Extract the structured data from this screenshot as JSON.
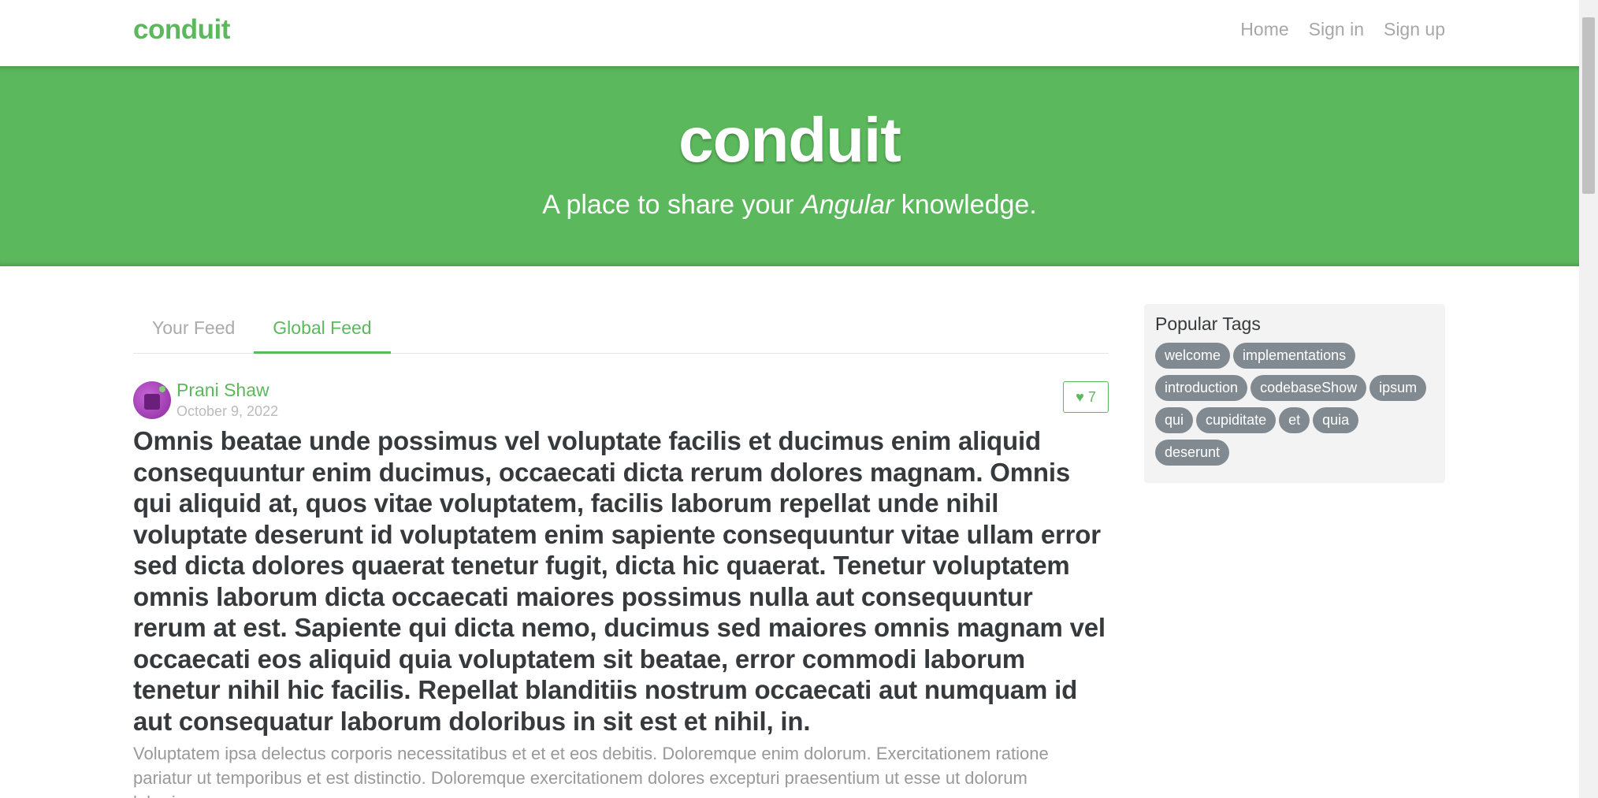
{
  "navbar": {
    "brand": "conduit",
    "links": [
      "Home",
      "Sign in",
      "Sign up"
    ]
  },
  "banner": {
    "title": "conduit",
    "subtitle_before": "A place to share your ",
    "subtitle_emphasis": "Angular",
    "subtitle_after": " knowledge."
  },
  "feed": {
    "tabs": [
      "Your Feed",
      "Global Feed"
    ],
    "active_tab": "Global Feed"
  },
  "article": {
    "author": "Prani Shaw",
    "date": "October 9, 2022",
    "likes": "7",
    "title": "Omnis beatae unde possimus vel voluptate facilis et ducimus enim aliquid consequuntur enim ducimus, occaecati dicta rerum dolores magnam. Omnis qui aliquid at, quos vitae voluptatem, facilis laborum repellat unde nihil voluptate deserunt id voluptatem enim sapiente consequuntur vitae ullam error sed dicta dolores quaerat tenetur fugit, dicta hic quaerat. Tenetur voluptatem omnis laborum dicta occaecati maiores possimus nulla aut consequuntur rerum at est. Sapiente qui dicta nemo, ducimus sed maiores omnis magnam vel occaecati eos aliquid quia voluptatem sit beatae, error commodi laborum tenetur nihil hic facilis. Repellat blanditiis nostrum occaecati aut numquam id aut consequatur laborum doloribus in sit est et nihil, in.",
    "description": "Voluptatem ipsa delectus corporis necessitatibus et et et eos debitis. Doloremque enim dolorum. Exercitationem ratione pariatur ut temporibus et est distinctio. Doloremque exercitationem dolores excepturi praesentium ut esse ut dolorum laboriosam."
  },
  "sidebar": {
    "title": "Popular Tags",
    "tags": [
      "welcome",
      "implementations",
      "introduction",
      "codebaseShow",
      "ipsum",
      "qui",
      "cupiditate",
      "et",
      "quia",
      "deserunt"
    ]
  },
  "colors": {
    "brand": "#5cb85c",
    "tag_bg": "#818a91",
    "sidebar_bg": "#f3f3f3"
  },
  "icons": {
    "like": "heart-icon"
  }
}
